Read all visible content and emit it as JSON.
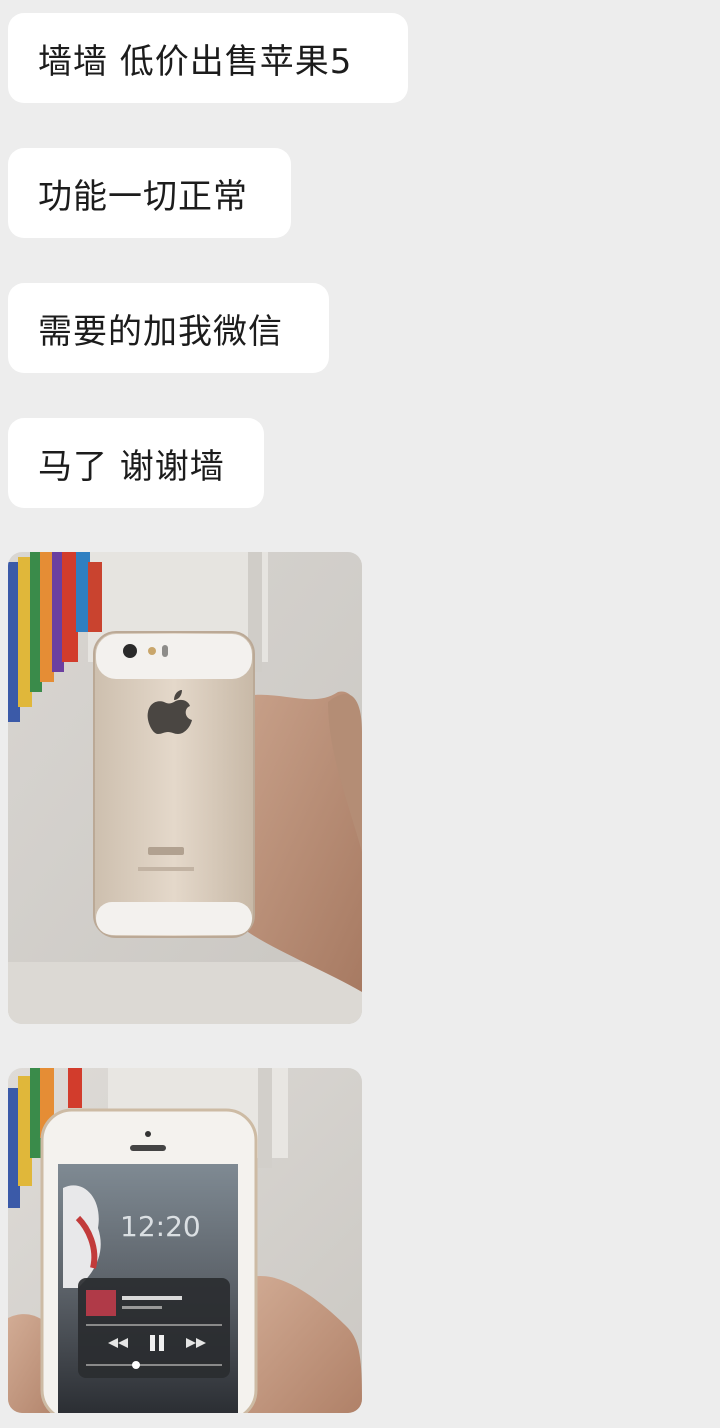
{
  "messages": [
    {
      "text": "墙墙 低价出售苹果5"
    },
    {
      "text": "功能一切正常"
    },
    {
      "text": "需要的加我微信"
    },
    {
      "text": "马了 谢谢墙"
    }
  ],
  "photos": [
    {
      "name": "photo-iphone-back"
    },
    {
      "name": "photo-iphone-front"
    }
  ],
  "colors": {
    "background": "#ededed",
    "bubble": "#ffffff",
    "text": "#1c1c1c"
  }
}
